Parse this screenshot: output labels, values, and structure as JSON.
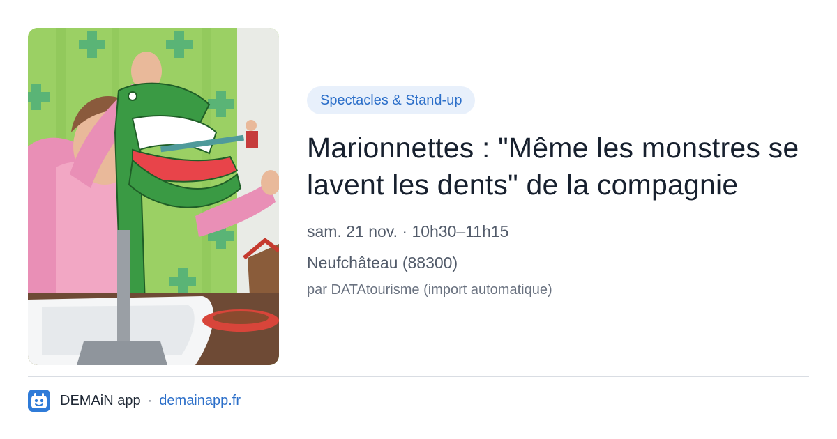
{
  "event": {
    "category": "Spectacles & Stand-up",
    "title": "Marionnettes : \"Même les monstres se lavent les dents\" de la compagnie",
    "date": "sam. 21 nov.",
    "separator": "·",
    "time": "10h30–11h15",
    "location": "Neufchâteau (88300)",
    "source": "par DATAtourisme (import automatique)"
  },
  "footer": {
    "app_name": "DEMAiN app",
    "separator": "·",
    "site": "demainapp.fr"
  },
  "colors": {
    "accent": "#2c6fc9",
    "category_bg": "#e8f0fb",
    "logo_bg": "#2f7bd8"
  }
}
